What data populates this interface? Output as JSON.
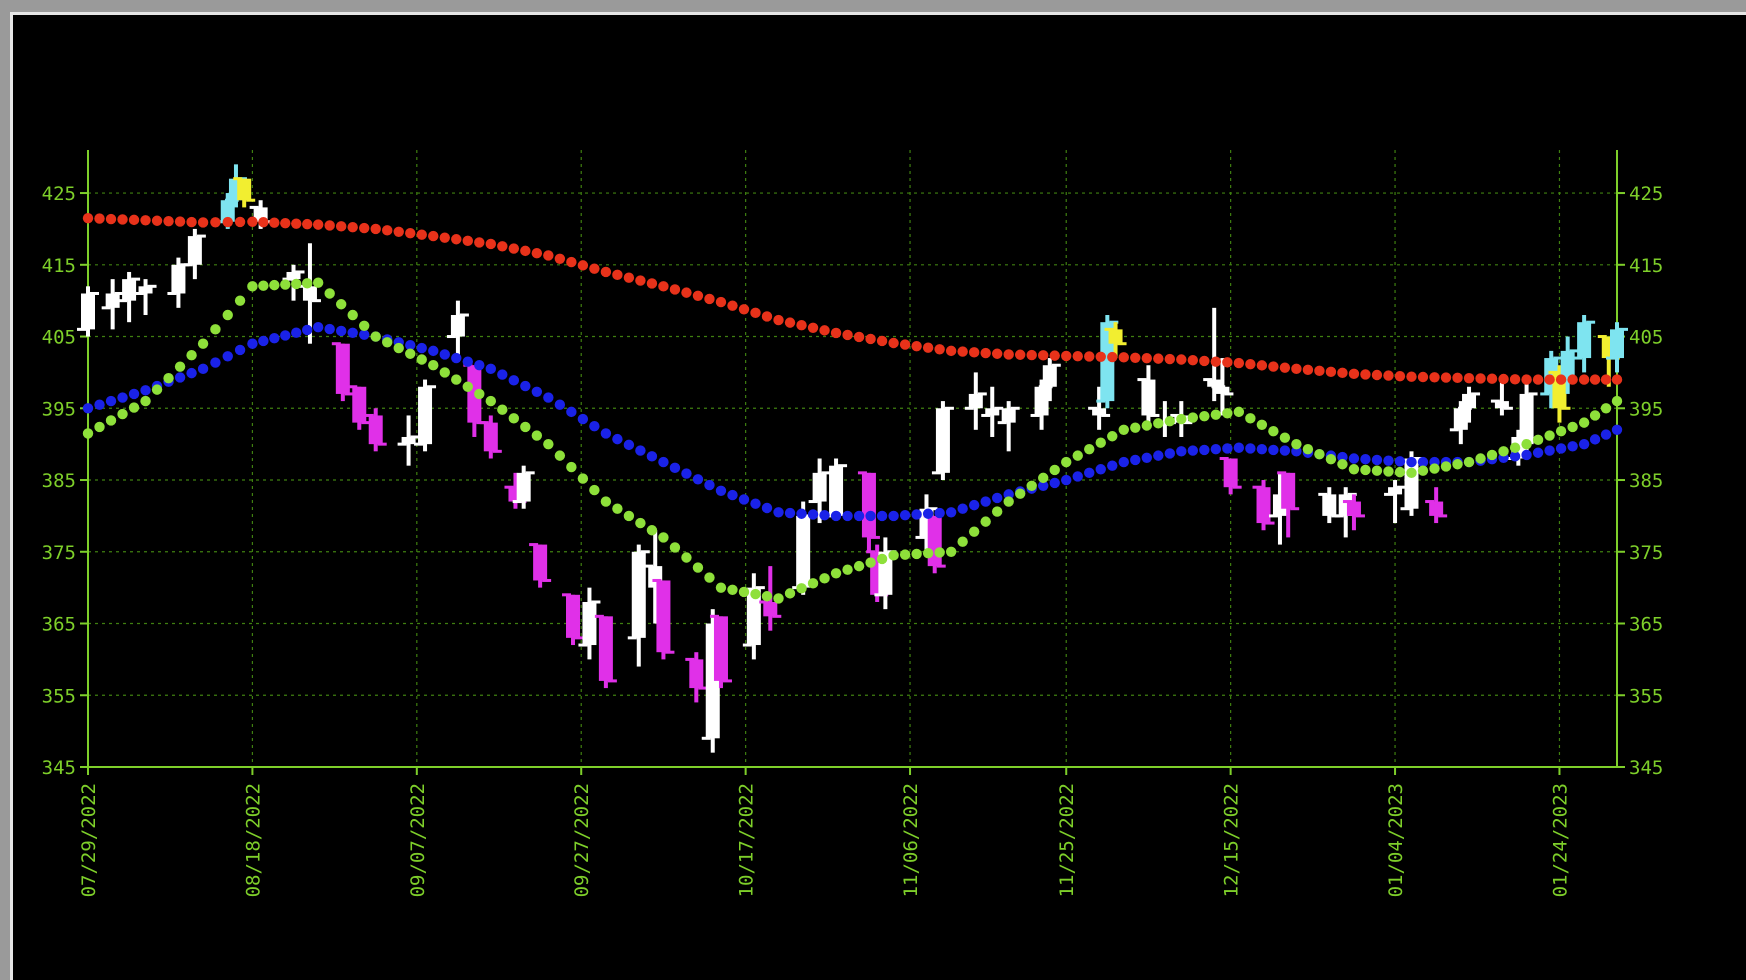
{
  "colors": {
    "background": "#000000",
    "axis": "#7ecf2a",
    "grid": "#3f7f10",
    "tick_text": "#7ecf2a",
    "bar_up": "#ffffff",
    "bar_down": "#e030e8",
    "bar_highlight_cyan": "#7ee4f0",
    "bar_highlight_yellow": "#f2ee30",
    "ma_red": "#e8321a",
    "ma_green": "#8ee03a",
    "ma_blue": "#1a22e8"
  },
  "chart_data": {
    "type": "bar",
    "subtype": "ohlc-with-moving-averages",
    "title": "",
    "xlabel": "",
    "ylabel": "",
    "ylim": [
      345,
      431
    ],
    "yticks": [
      345,
      355,
      365,
      375,
      385,
      395,
      405,
      415,
      425
    ],
    "y_axis": "both-sides",
    "grid": true,
    "xlim": [
      "07/29/2022",
      "01/31/2023"
    ],
    "xticks": [
      "07/29/2022",
      "08/18/2022",
      "09/07/2022",
      "09/27/2022",
      "10/17/2022",
      "11/06/2022",
      "11/25/2022",
      "12/15/2022",
      "01/04/2023",
      "01/24/2023"
    ],
    "series": [
      {
        "kind": "moving-average",
        "color": "red",
        "x": [
          "07/29/2022",
          "08/05/2022",
          "08/12/2022",
          "08/18/2022",
          "08/26/2022",
          "09/02/2022",
          "09/09/2022",
          "09/16/2022",
          "09/23/2022",
          "09/30/2022",
          "10/07/2022",
          "10/14/2022",
          "10/21/2022",
          "10/28/2022",
          "11/04/2022",
          "11/11/2022",
          "11/18/2022",
          "11/25/2022",
          "12/02/2022",
          "12/09/2022",
          "12/16/2022",
          "12/23/2022",
          "12/30/2022",
          "01/06/2023",
          "01/13/2023",
          "01/20/2023",
          "01/27/2023",
          "01/31/2023"
        ],
        "values": [
          421.5,
          421.2,
          420.9,
          421.0,
          420.6,
          420.0,
          419.0,
          417.9,
          416.3,
          414.0,
          412.0,
          409.8,
          407.3,
          405.5,
          404.1,
          403.0,
          402.5,
          402.3,
          402.1,
          401.8,
          401.3,
          400.5,
          399.8,
          399.4,
          399.2,
          399.0,
          399.0,
          399.0
        ]
      },
      {
        "kind": "moving-average",
        "color": "blue",
        "x": [
          "07/29/2022",
          "08/05/2022",
          "08/12/2022",
          "08/18/2022",
          "08/26/2022",
          "09/02/2022",
          "09/09/2022",
          "09/16/2022",
          "09/23/2022",
          "09/30/2022",
          "10/07/2022",
          "10/14/2022",
          "10/21/2022",
          "10/28/2022",
          "11/04/2022",
          "11/11/2022",
          "11/18/2022",
          "11/25/2022",
          "12/02/2022",
          "12/09/2022",
          "12/16/2022",
          "12/23/2022",
          "12/30/2022",
          "01/06/2023",
          "01/13/2023",
          "01/20/2023",
          "01/27/2023",
          "01/31/2023"
        ],
        "values": [
          395.0,
          397.5,
          400.5,
          404.0,
          406.3,
          405.0,
          403.0,
          400.5,
          396.5,
          391.5,
          387.5,
          383.5,
          380.5,
          380.0,
          380.0,
          380.5,
          383.0,
          385.0,
          387.5,
          389.0,
          389.5,
          389.0,
          388.0,
          387.5,
          387.5,
          388.5,
          390.0,
          392.0
        ]
      },
      {
        "kind": "moving-average",
        "color": "green",
        "x": [
          "07/29/2022",
          "08/05/2022",
          "08/12/2022",
          "08/18/2022",
          "08/26/2022",
          "09/02/2022",
          "09/09/2022",
          "09/16/2022",
          "09/23/2022",
          "09/30/2022",
          "10/07/2022",
          "10/14/2022",
          "10/21/2022",
          "10/28/2022",
          "11/04/2022",
          "11/11/2022",
          "11/18/2022",
          "11/25/2022",
          "12/02/2022",
          "12/09/2022",
          "12/16/2022",
          "12/23/2022",
          "12/30/2022",
          "01/06/2023",
          "01/13/2023",
          "01/20/2023",
          "01/27/2023",
          "01/31/2023"
        ],
        "values": [
          391.5,
          396.0,
          404.0,
          412.0,
          412.5,
          405.0,
          401.0,
          396.0,
          390.0,
          382.0,
          377.0,
          370.0,
          368.5,
          372.0,
          374.5,
          375.0,
          382.0,
          387.5,
          392.0,
          393.5,
          394.5,
          390.0,
          386.5,
          386.0,
          387.5,
          390.0,
          393.0,
          396.0
        ]
      }
    ],
    "bars": [
      {
        "x": "07/29/2022",
        "open": 406,
        "high": 412,
        "low": 405,
        "close": 411,
        "color": "up"
      },
      {
        "x": "08/01/2022",
        "open": 409,
        "high": 413,
        "low": 406,
        "close": 411,
        "color": "up"
      },
      {
        "x": "08/03/2022",
        "open": 410,
        "high": 414,
        "low": 407,
        "close": 413,
        "color": "up"
      },
      {
        "x": "08/05/2022",
        "open": 411,
        "high": 413,
        "low": 408,
        "close": 412,
        "color": "up"
      },
      {
        "x": "08/09/2022",
        "open": 411,
        "high": 416,
        "low": 409,
        "close": 415,
        "color": "up"
      },
      {
        "x": "08/11/2022",
        "open": 415,
        "high": 420,
        "low": 413,
        "close": 419,
        "color": "up"
      },
      {
        "x": "08/15/2022",
        "open": 421,
        "high": 425,
        "low": 420,
        "close": 424,
        "color": "cyan"
      },
      {
        "x": "08/16/2022",
        "open": 424,
        "high": 429,
        "low": 423,
        "close": 427,
        "color": "cyan"
      },
      {
        "x": "08/17/2022",
        "open": 427,
        "high": 427,
        "low": 423,
        "close": 424,
        "color": "yellow"
      },
      {
        "x": "08/19/2022",
        "open": 423,
        "high": 424,
        "low": 420,
        "close": 421,
        "color": "up"
      },
      {
        "x": "08/23/2022",
        "open": 413,
        "high": 415,
        "low": 410,
        "close": 414,
        "color": "up"
      },
      {
        "x": "08/25/2022",
        "open": 412,
        "high": 418,
        "low": 404,
        "close": 410,
        "color": "up"
      },
      {
        "x": "08/29/2022",
        "open": 404,
        "high": 404,
        "low": 396,
        "close": 397,
        "color": "down"
      },
      {
        "x": "08/31/2022",
        "open": 398,
        "high": 398,
        "low": 392,
        "close": 393,
        "color": "down"
      },
      {
        "x": "09/02/2022",
        "open": 394,
        "high": 395,
        "low": 389,
        "close": 390,
        "color": "down"
      },
      {
        "x": "09/06/2022",
        "open": 390,
        "high": 394,
        "low": 387,
        "close": 391,
        "color": "up"
      },
      {
        "x": "09/08/2022",
        "open": 390,
        "high": 399,
        "low": 389,
        "close": 398,
        "color": "up"
      },
      {
        "x": "09/12/2022",
        "open": 405,
        "high": 410,
        "low": 402,
        "close": 408,
        "color": "up"
      },
      {
        "x": "09/14/2022",
        "open": 401,
        "high": 401,
        "low": 391,
        "close": 393,
        "color": "down"
      },
      {
        "x": "09/16/2022",
        "open": 393,
        "high": 394,
        "low": 388,
        "close": 389,
        "color": "down"
      },
      {
        "x": "09/19/2022",
        "open": 384,
        "high": 386,
        "low": 381,
        "close": 382,
        "color": "down"
      },
      {
        "x": "09/20/2022",
        "open": 382,
        "high": 387,
        "low": 381,
        "close": 386,
        "color": "up"
      },
      {
        "x": "09/22/2022",
        "open": 376,
        "high": 376,
        "low": 370,
        "close": 371,
        "color": "down"
      },
      {
        "x": "09/26/2022",
        "open": 369,
        "high": 369,
        "low": 362,
        "close": 363,
        "color": "down"
      },
      {
        "x": "09/28/2022",
        "open": 362,
        "high": 370,
        "low": 360,
        "close": 368,
        "color": "up"
      },
      {
        "x": "09/30/2022",
        "open": 366,
        "high": 366,
        "low": 356,
        "close": 357,
        "color": "down"
      },
      {
        "x": "10/04/2022",
        "open": 363,
        "high": 376,
        "low": 359,
        "close": 375,
        "color": "up"
      },
      {
        "x": "10/06/2022",
        "open": 373,
        "high": 378,
        "low": 365,
        "close": 370,
        "color": "up"
      },
      {
        "x": "10/07/2022",
        "open": 371,
        "high": 371,
        "low": 360,
        "close": 361,
        "color": "down"
      },
      {
        "x": "10/11/2022",
        "open": 360,
        "high": 361,
        "low": 354,
        "close": 356,
        "color": "down"
      },
      {
        "x": "10/13/2022",
        "open": 349,
        "high": 367,
        "low": 347,
        "close": 365,
        "color": "up"
      },
      {
        "x": "10/14/2022",
        "open": 366,
        "high": 366,
        "low": 356,
        "close": 357,
        "color": "down"
      },
      {
        "x": "10/18/2022",
        "open": 362,
        "high": 372,
        "low": 360,
        "close": 370,
        "color": "up"
      },
      {
        "x": "10/20/2022",
        "open": 368,
        "high": 373,
        "low": 364,
        "close": 366,
        "color": "down"
      },
      {
        "x": "10/24/2022",
        "open": 370,
        "high": 382,
        "low": 369,
        "close": 380,
        "color": "up"
      },
      {
        "x": "10/26/2022",
        "open": 382,
        "high": 388,
        "low": 379,
        "close": 386,
        "color": "up"
      },
      {
        "x": "10/28/2022",
        "open": 380,
        "high": 388,
        "low": 380,
        "close": 387,
        "color": "up"
      },
      {
        "x": "11/01/2022",
        "open": 386,
        "high": 386,
        "low": 375,
        "close": 377,
        "color": "down"
      },
      {
        "x": "11/02/2022",
        "open": 375,
        "high": 376,
        "low": 368,
        "close": 369,
        "color": "down"
      },
      {
        "x": "11/03/2022",
        "open": 369,
        "high": 377,
        "low": 367,
        "close": 375,
        "color": "up"
      },
      {
        "x": "11/08/2022",
        "open": 377,
        "high": 383,
        "low": 375,
        "close": 381,
        "color": "up"
      },
      {
        "x": "11/09/2022",
        "open": 380,
        "high": 380,
        "low": 372,
        "close": 373,
        "color": "down"
      },
      {
        "x": "11/10/2022",
        "open": 386,
        "high": 396,
        "low": 385,
        "close": 395,
        "color": "up"
      },
      {
        "x": "11/14/2022",
        "open": 395,
        "high": 400,
        "low": 392,
        "close": 397,
        "color": "up"
      },
      {
        "x": "11/16/2022",
        "open": 394,
        "high": 398,
        "low": 391,
        "close": 395,
        "color": "up"
      },
      {
        "x": "11/18/2022",
        "open": 393,
        "high": 396,
        "low": 389,
        "close": 395,
        "color": "up"
      },
      {
        "x": "11/22/2022",
        "open": 394,
        "high": 399,
        "low": 392,
        "close": 398,
        "color": "up"
      },
      {
        "x": "11/23/2022",
        "open": 398,
        "high": 402,
        "low": 396,
        "close": 401,
        "color": "up"
      },
      {
        "x": "11/29/2022",
        "open": 395,
        "high": 398,
        "low": 392,
        "close": 394,
        "color": "up"
      },
      {
        "x": "11/30/2022",
        "open": 396,
        "high": 408,
        "low": 395,
        "close": 407,
        "color": "cyan"
      },
      {
        "x": "12/01/2022",
        "open": 406,
        "high": 407,
        "low": 402,
        "close": 404,
        "color": "yellow"
      },
      {
        "x": "12/05/2022",
        "open": 399,
        "high": 401,
        "low": 393,
        "close": 394,
        "color": "up"
      },
      {
        "x": "12/07/2022",
        "open": 393,
        "high": 396,
        "low": 391,
        "close": 393,
        "color": "up"
      },
      {
        "x": "12/09/2022",
        "open": 394,
        "high": 396,
        "low": 391,
        "close": 393,
        "color": "up"
      },
      {
        "x": "12/13/2022",
        "open": 399,
        "high": 409,
        "low": 396,
        "close": 398,
        "color": "up"
      },
      {
        "x": "12/14/2022",
        "open": 398,
        "high": 402,
        "low": 394,
        "close": 397,
        "color": "up"
      },
      {
        "x": "12/15/2022",
        "open": 388,
        "high": 388,
        "low": 383,
        "close": 384,
        "color": "down"
      },
      {
        "x": "12/19/2022",
        "open": 384,
        "high": 385,
        "low": 378,
        "close": 379,
        "color": "down"
      },
      {
        "x": "12/21/2022",
        "open": 380,
        "high": 386,
        "low": 376,
        "close": 383,
        "color": "up"
      },
      {
        "x": "12/22/2022",
        "open": 386,
        "high": 386,
        "low": 377,
        "close": 381,
        "color": "down"
      },
      {
        "x": "12/27/2022",
        "open": 383,
        "high": 384,
        "low": 379,
        "close": 380,
        "color": "up"
      },
      {
        "x": "12/29/2022",
        "open": 380,
        "high": 384,
        "low": 377,
        "close": 383,
        "color": "up"
      },
      {
        "x": "12/30/2022",
        "open": 382,
        "high": 383,
        "low": 378,
        "close": 380,
        "color": "down"
      },
      {
        "x": "01/04/2023",
        "open": 383,
        "high": 385,
        "low": 379,
        "close": 384,
        "color": "up"
      },
      {
        "x": "01/06/2023",
        "open": 381,
        "high": 389,
        "low": 380,
        "close": 388,
        "color": "up"
      },
      {
        "x": "01/09/2023",
        "open": 382,
        "high": 384,
        "low": 379,
        "close": 380,
        "color": "down"
      },
      {
        "x": "01/12/2023",
        "open": 392,
        "high": 396,
        "low": 390,
        "close": 395,
        "color": "up"
      },
      {
        "x": "01/13/2023",
        "open": 395,
        "high": 398,
        "low": 393,
        "close": 397,
        "color": "up"
      },
      {
        "x": "01/17/2023",
        "open": 396,
        "high": 399,
        "low": 394,
        "close": 395,
        "color": "up"
      },
      {
        "x": "01/19/2023",
        "open": 388,
        "high": 392,
        "low": 387,
        "close": 391,
        "color": "up"
      },
      {
        "x": "01/20/2023",
        "open": 390,
        "high": 399,
        "low": 388,
        "close": 397,
        "color": "up"
      },
      {
        "x": "01/23/2023",
        "open": 397,
        "high": 403,
        "low": 395,
        "close": 402,
        "color": "cyan"
      },
      {
        "x": "01/24/2023",
        "open": 400,
        "high": 401,
        "low": 393,
        "close": 395,
        "color": "yellow"
      },
      {
        "x": "01/25/2023",
        "open": 399,
        "high": 405,
        "low": 397,
        "close": 403,
        "color": "cyan"
      },
      {
        "x": "01/27/2023",
        "open": 402,
        "high": 408,
        "low": 400,
        "close": 407,
        "color": "cyan"
      },
      {
        "x": "01/30/2023",
        "open": 405,
        "high": 405,
        "low": 398,
        "close": 402,
        "color": "yellow"
      },
      {
        "x": "01/31/2023",
        "open": 402,
        "high": 407,
        "low": 400,
        "close": 406,
        "color": "cyan"
      }
    ]
  }
}
